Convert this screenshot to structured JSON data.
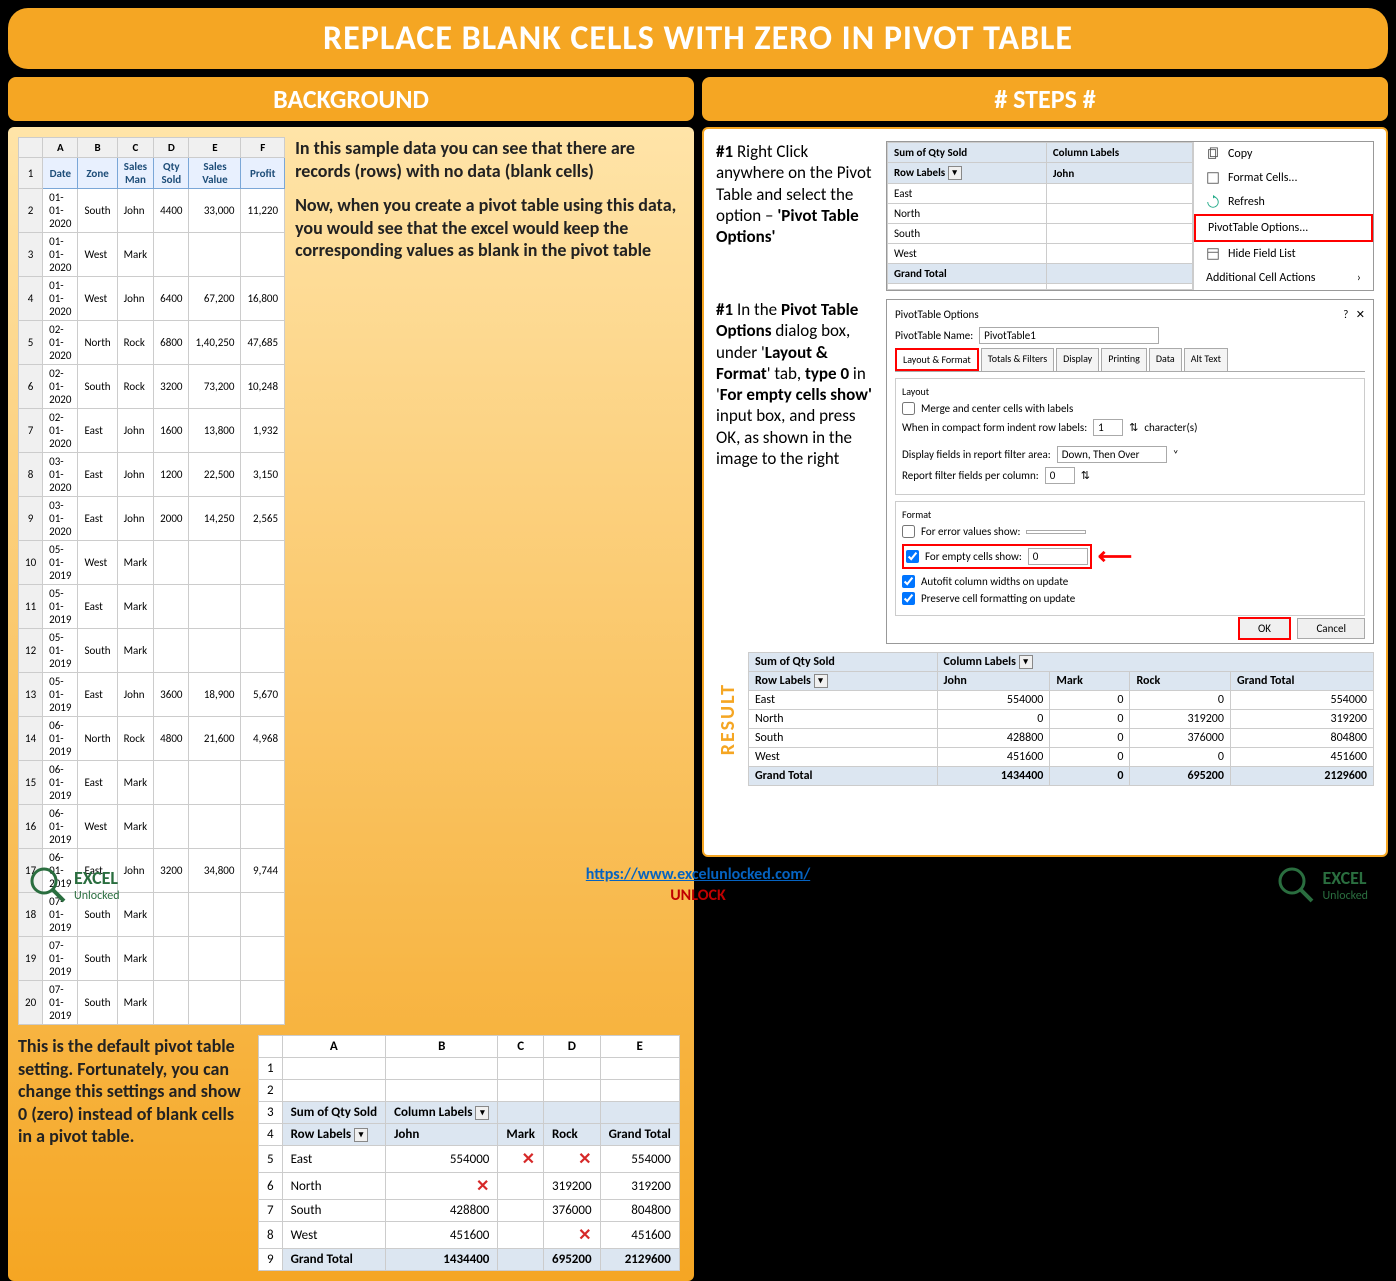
{
  "title": "REPLACE BLANK CELLS WITH ZERO IN PIVOT TABLE",
  "left": {
    "header": "BACKGROUND",
    "cols": [
      "A",
      "B",
      "C",
      "D",
      "E",
      "F"
    ],
    "fields": [
      "Date",
      "Zone",
      "Sales Man",
      "Qty Sold",
      "Sales Value",
      "Profit"
    ],
    "rows": [
      [
        "01-01-2020",
        "South",
        "John",
        "4400",
        "33,000",
        "11,220"
      ],
      [
        "01-01-2020",
        "West",
        "Mark",
        "",
        "",
        ""
      ],
      [
        "01-01-2020",
        "West",
        "John",
        "6400",
        "67,200",
        "16,800"
      ],
      [
        "02-01-2020",
        "North",
        "Rock",
        "6800",
        "1,40,250",
        "47,685"
      ],
      [
        "02-01-2020",
        "South",
        "Rock",
        "3200",
        "73,200",
        "10,248"
      ],
      [
        "02-01-2020",
        "East",
        "John",
        "1600",
        "13,800",
        "1,932"
      ],
      [
        "03-01-2020",
        "East",
        "John",
        "1200",
        "22,500",
        "3,150"
      ],
      [
        "03-01-2020",
        "East",
        "John",
        "2000",
        "14,250",
        "2,565"
      ],
      [
        "05-01-2019",
        "West",
        "Mark",
        "",
        "",
        ""
      ],
      [
        "05-01-2019",
        "East",
        "Mark",
        "",
        "",
        ""
      ],
      [
        "05-01-2019",
        "South",
        "Mark",
        "",
        "",
        ""
      ],
      [
        "05-01-2019",
        "East",
        "John",
        "3600",
        "18,900",
        "5,670"
      ],
      [
        "06-01-2019",
        "North",
        "Rock",
        "4800",
        "21,600",
        "4,968"
      ],
      [
        "06-01-2019",
        "East",
        "Mark",
        "",
        "",
        ""
      ],
      [
        "06-01-2019",
        "West",
        "Mark",
        "",
        "",
        ""
      ],
      [
        "06-01-2019",
        "East",
        "John",
        "3200",
        "34,800",
        "9,744"
      ],
      [
        "07-01-2019",
        "South",
        "Mark",
        "",
        "",
        ""
      ],
      [
        "07-01-2019",
        "South",
        "Mark",
        "",
        "",
        ""
      ],
      [
        "07-01-2019",
        "South",
        "Mark",
        "",
        "",
        ""
      ]
    ],
    "desc1": "In this sample data you can see that there are records (rows) with no data (blank cells)",
    "desc2": "Now, when you create a pivot table using this data, you would see that the excel would keep the corresponding values as blank in the pivot table",
    "desc3": "This is the default pivot table setting. Fortunately, you can change this settings and show 0 (zero) instead of blank cells in a pivot table.",
    "pivot_cols": [
      "A",
      "B",
      "C",
      "D",
      "E"
    ],
    "pivot": {
      "value_field": "Sum of Qty Sold",
      "col_label": "Column Labels",
      "row_label": "Row Labels",
      "sales": [
        "John",
        "Mark",
        "Rock"
      ],
      "grand": "Grand Total",
      "rows": [
        {
          "label": "East",
          "john": "554000",
          "mark": "X",
          "rock": "X",
          "total": "554000"
        },
        {
          "label": "North",
          "john": "X",
          "mark": "",
          "rock": "319200",
          "total": "319200"
        },
        {
          "label": "South",
          "john": "428800",
          "mark": "",
          "rock": "376000",
          "total": "804800"
        },
        {
          "label": "West",
          "john": "451600",
          "mark": "",
          "rock": "X",
          "total": "451600"
        }
      ],
      "total": {
        "label": "Grand Total",
        "john": "1434400",
        "mark": "",
        "rock": "695200",
        "total": "2129600"
      }
    }
  },
  "right": {
    "header": "# STEPS #",
    "step1_num": "#1",
    "step1": "Right Click anywhere on the Pivot Table and select the option – ",
    "step1_opt": "'Pivot Table Options'",
    "mini_pivot": {
      "vf": "Sum of Qty Sold",
      "cl": "Column Labels",
      "rl": "Row Labels",
      "john": "John",
      "zones": [
        "East",
        "North",
        "South",
        "West"
      ],
      "gt": "Grand Total"
    },
    "menu": {
      "copy": "Copy",
      "format": "Format Cells...",
      "refresh": "Refresh",
      "options": "PivotTable Options...",
      "hide": "Hide Field List",
      "more": "Additional Cell Actions"
    },
    "step2_num": "#1",
    "step2_a": "In the ",
    "step2_b": "Pivot Table Options",
    "step2_c": " dialog box, under '",
    "step2_d": "Layout & Format",
    "step2_e": "' tab, ",
    "step2_f": "type 0",
    "step2_g": " in '",
    "step2_h": "For empty cells show'",
    "step2_i": " input box, and press OK, as shown in the image to the right",
    "dialog": {
      "title": "PivotTable Options",
      "name_label": "PivotTable Name:",
      "name_value": "PivotTable1",
      "tabs": [
        "Layout & Format",
        "Totals & Filters",
        "Display",
        "Printing",
        "Data",
        "Alt Text"
      ],
      "layout_title": "Layout",
      "merge": "Merge and center cells with labels",
      "indent": "When in compact form indent row labels:",
      "indent_val": "1",
      "indent_suffix": "character(s)",
      "display_fields": "Display fields in report filter area:",
      "display_val": "Down, Then Over",
      "report_filter": "Report filter fields per column:",
      "report_val": "0",
      "format_title": "Format",
      "error": "For error values show:",
      "empty": "For empty cells show:",
      "empty_val": "0",
      "autofit": "Autofit column widths on update",
      "preserve": "Preserve cell formatting on update",
      "ok": "OK",
      "cancel": "Cancel"
    },
    "result_label": "RESULT",
    "result": {
      "vf": "Sum of Qty Sold",
      "cl": "Column Labels",
      "rl": "Row Labels",
      "sales": [
        "John",
        "Mark",
        "Rock"
      ],
      "gt": "Grand Total",
      "rows": [
        {
          "l": "East",
          "j": "554000",
          "m": "0",
          "r": "0",
          "t": "554000"
        },
        {
          "l": "North",
          "j": "0",
          "m": "0",
          "r": "319200",
          "t": "319200"
        },
        {
          "l": "South",
          "j": "428800",
          "m": "0",
          "r": "376000",
          "t": "804800"
        },
        {
          "l": "West",
          "j": "451600",
          "m": "0",
          "r": "0",
          "t": "451600"
        }
      ],
      "total": {
        "l": "Grand Total",
        "j": "1434400",
        "m": "0",
        "r": "695200",
        "t": "2129600"
      }
    }
  },
  "footer": {
    "logo1": "EXCEL",
    "logo1b": "Unlocked",
    "url": "https://www.excelunlocked.com/",
    "unlock": "UNLOCK",
    "logo2": "EXCEL",
    "logo2b": "Unlocked"
  }
}
